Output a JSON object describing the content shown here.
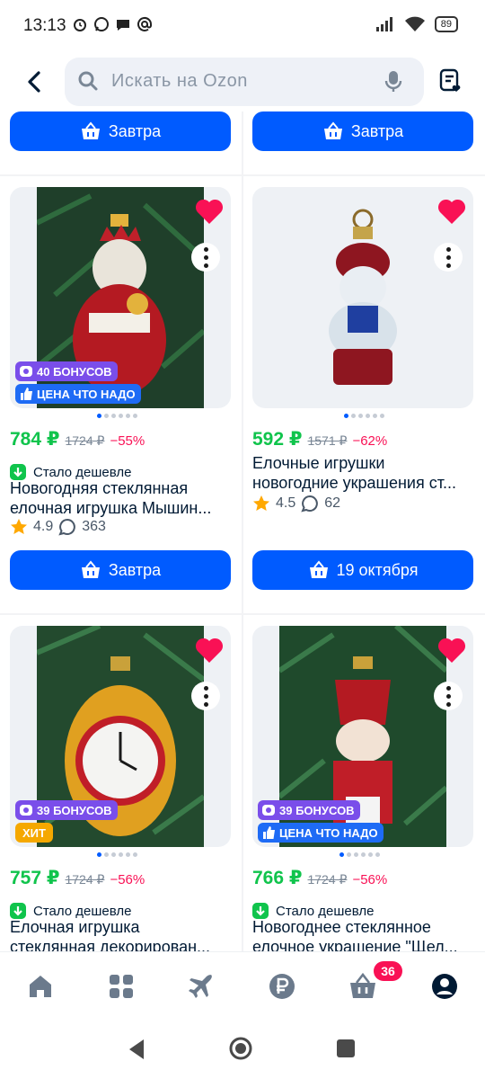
{
  "status_bar": {
    "time": "13:13",
    "battery": "89"
  },
  "search": {
    "placeholder": "Искать на Ozon"
  },
  "top_buttons": [
    {
      "label": "Завтра"
    },
    {
      "label": "Завтра"
    }
  ],
  "products": [
    {
      "price": "784 ₽",
      "old_price": "1724 ₽",
      "discount": "−55%",
      "badges": [
        "40 БОНУСОВ",
        "ЦЕНА ЧТО НАДО"
      ],
      "cheaper_label": "Стало дешевле",
      "title_lines": [
        "Новогодняя стеклянная",
        "елочная игрушка Мышин..."
      ],
      "rating": "4.9",
      "reviews": "363",
      "button": "Завтра"
    },
    {
      "price": "592 ₽",
      "old_price": "1571 ₽",
      "discount": "−62%",
      "badges": [],
      "title_lines": [
        "Елочные игрушки",
        "новогодние украшения ст..."
      ],
      "rating": "4.5",
      "reviews": "62",
      "button": "19 октября"
    },
    {
      "price": "757 ₽",
      "old_price": "1724 ₽",
      "discount": "−56%",
      "badges": [
        "39 БОНУСОВ",
        "ХИТ"
      ],
      "cheaper_label": "Стало дешевле",
      "title_lines": [
        "Елочная игрушка",
        "стеклянная декорирован..."
      ]
    },
    {
      "price": "766 ₽",
      "old_price": "1724 ₽",
      "discount": "−56%",
      "badges": [
        "39 БОНУСОВ",
        "ЦЕНА ЧТО НАДО"
      ],
      "cheaper_label": "Стало дешевле",
      "title_lines": [
        "Новогоднее стеклянное",
        "елочное украшение \"Щел..."
      ]
    }
  ],
  "bottom_nav": {
    "cart_count": "36"
  },
  "colors": {
    "accent": "#005bff",
    "price_green": "#10c44c",
    "discount_pink": "#f91155",
    "bonus_purple": "#7a4eea",
    "hit_orange": "#f5a800"
  }
}
